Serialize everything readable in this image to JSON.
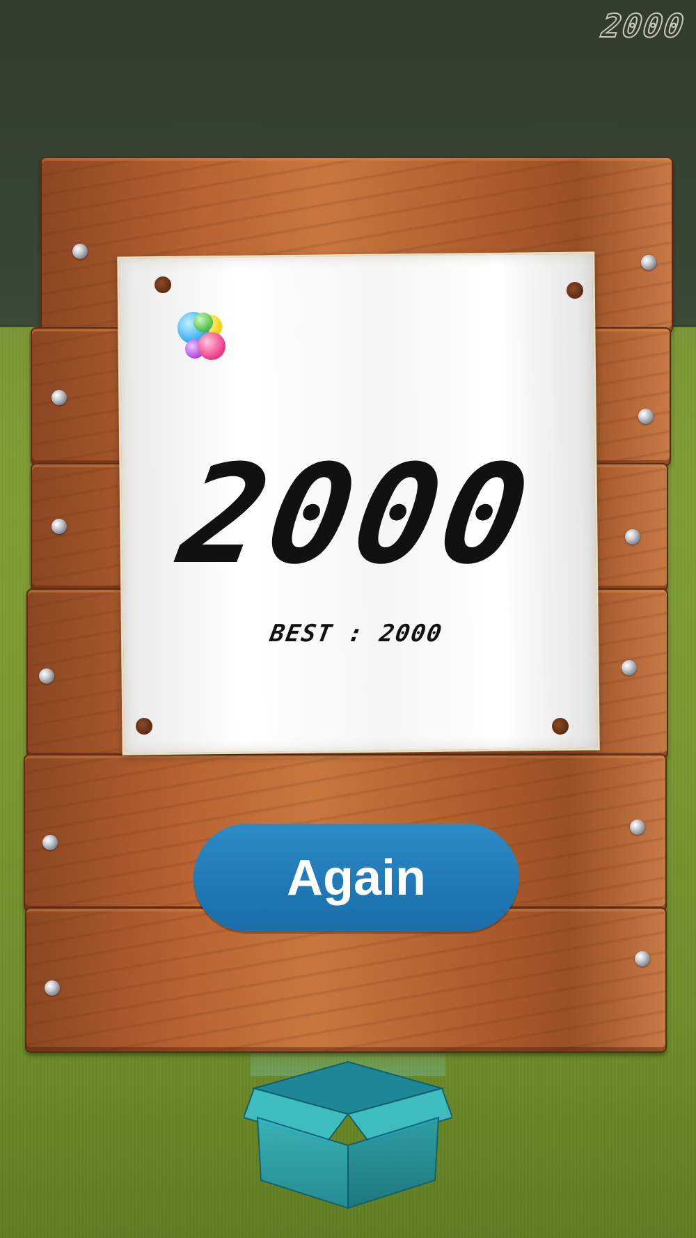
{
  "hud": {
    "current_score": "2000"
  },
  "score_card": {
    "score": "2000",
    "best_label": "BEST",
    "best_separator": ":",
    "best_value": "2000",
    "game_center_icon": "game-center-icon"
  },
  "actions": {
    "again_label": "Again"
  },
  "scene": {
    "sign": "wooden-sign",
    "box_icon": "open-box-icon"
  },
  "colors": {
    "button": "#1f78b5",
    "wall": "#343f30",
    "grass": "#7b9a32",
    "wood": "#b86331",
    "box": "#2aa6b4"
  }
}
